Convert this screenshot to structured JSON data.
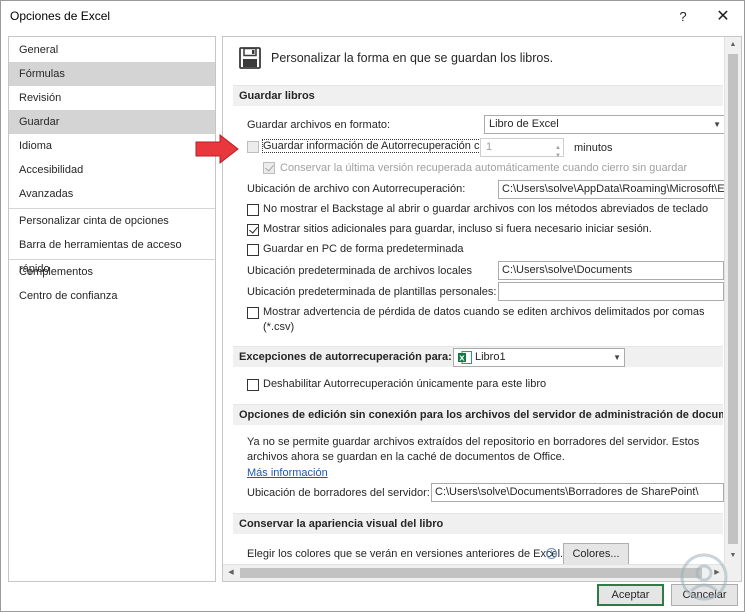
{
  "window": {
    "title": "Opciones de Excel",
    "help": "?",
    "close": "✕"
  },
  "sidebar": {
    "items": [
      {
        "label": "General",
        "selected": false
      },
      {
        "label": "Fórmulas",
        "selected": true
      },
      {
        "label": "Revisión",
        "selected": false
      },
      {
        "label": "Guardar",
        "selected": true
      },
      {
        "label": "Idioma",
        "selected": false
      },
      {
        "label": "Accesibilidad",
        "selected": false
      },
      {
        "label": "Avanzadas",
        "selected": false
      },
      {
        "label": "Personalizar cinta de opciones",
        "selected": false
      },
      {
        "label": "Barra de herramientas de acceso rápido",
        "selected": false
      },
      {
        "label": "Complementos",
        "selected": false
      },
      {
        "label": "Centro de confianza",
        "selected": false
      }
    ]
  },
  "main": {
    "heading": "Personalizar la forma en que se guardan los libros.",
    "save_section": {
      "title": "Guardar libros",
      "format_label": "Guardar archivos en formato:",
      "format_value": "Libro de Excel",
      "autorecover_label": "Guardar información de Autorrecuperación cada",
      "autorecover_minutes": "1",
      "minutes_label": "minutos",
      "keep_last_label": "Conservar la última versión recuperada automáticamente cuando cierro sin guardar",
      "autorecover_location_label": "Ubicación de archivo con Autorrecuperación:",
      "autorecover_location_value": "C:\\Users\\solve\\AppData\\Roaming\\Microsoft\\E",
      "no_backstage_label": "No mostrar el Backstage al abrir o guardar archivos con los métodos abreviados de teclado",
      "show_sites_label": "Mostrar sitios adicionales para guardar, incluso si fuera necesario iniciar sesión.",
      "save_pc_label": "Guardar en PC de forma predeterminada",
      "default_location_label": "Ubicación predeterminada de archivos locales",
      "default_location_value": "C:\\Users\\solve\\Documents",
      "templates_label": "Ubicación predeterminada de plantillas personales:",
      "templates_value": "",
      "warning_label_1": "Mostrar advertencia de pérdida de datos cuando se editen archivos delimitados por comas",
      "warning_label_2": "(*.csv)"
    },
    "exceptions_section": {
      "title": "Excepciones de autorrecuperación para:",
      "workbook": "Libro1",
      "disable_label": "Deshabilitar Autorrecuperación únicamente para este libro"
    },
    "offline_section": {
      "title": "Opciones de edición sin conexión para los archivos del servidor de administración de documentos",
      "text_1": "Ya no se permite guardar archivos extraídos del repositorio en borradores del servidor. Estos",
      "text_2": "archivos ahora se guardan en la caché de documentos de Office.",
      "more_info": "Más información",
      "drafts_label": "Ubicación de borradores del servidor:",
      "drafts_value": "C:\\Users\\solve\\Documents\\Borradores de SharePoint\\"
    },
    "visual_section": {
      "title": "Conservar la apariencia visual del libro",
      "colors_label": "Elegir los colores que se verán en versiones anteriores de Excel.",
      "colors_button": "Colores..."
    }
  },
  "footer": {
    "ok": "Aceptar",
    "cancel": "Cancelar"
  },
  "colors": {
    "accent_green": "#2f7a47",
    "annotation_red": "#e8373d",
    "selected_bg": "#d4d4d4"
  }
}
